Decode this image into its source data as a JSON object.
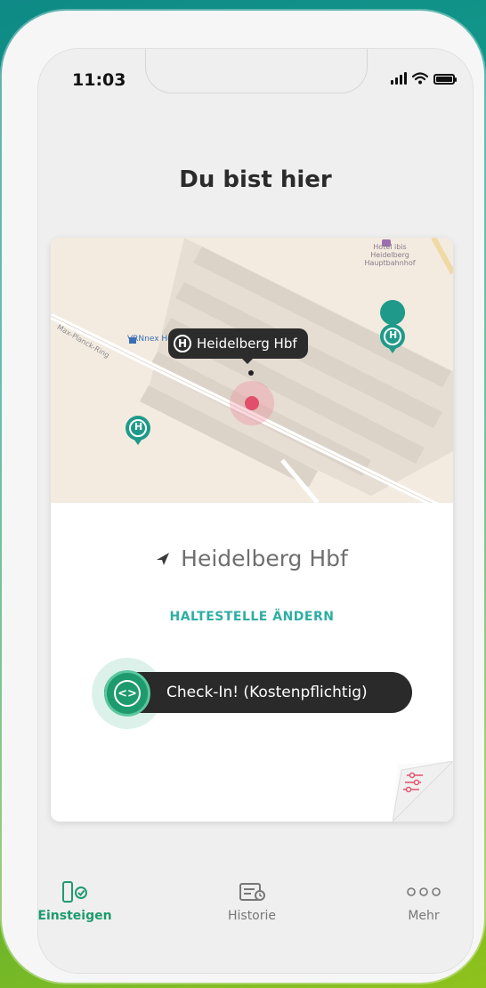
{
  "status_bar": {
    "time": "11:03"
  },
  "header": {
    "title": "Du bist hier"
  },
  "map": {
    "tooltip_label": "Heidelberg Hbf",
    "vrn_label": "VRNnex Heidelb",
    "hotel_label": "Hotel ibis Heidelberg Hauptbahnhof",
    "street_label": "Max-Planck-Ring",
    "stop_marker_letter": "H"
  },
  "station": {
    "name": "Heidelberg Hbf",
    "icon": "location-arrow-icon"
  },
  "actions": {
    "change_stop": "HALTESTELLE ÄNDERN",
    "checkin": "Check-In! (Kostenpflichtig)",
    "checkin_icon": "code-brackets-icon",
    "settings_icon": "sliders-icon"
  },
  "tabs": [
    {
      "label": "Einsteigen",
      "icon": "ticket-check-icon",
      "active": true
    },
    {
      "label": "Historie",
      "icon": "history-icon",
      "active": false
    },
    {
      "label": "Mehr",
      "icon": "more-dots-icon",
      "active": false
    }
  ],
  "colors": {
    "accent": "#1f9a6f",
    "link": "#2eaea3",
    "location_dot": "#e0506a",
    "dark_pill": "#2a2a2a"
  }
}
